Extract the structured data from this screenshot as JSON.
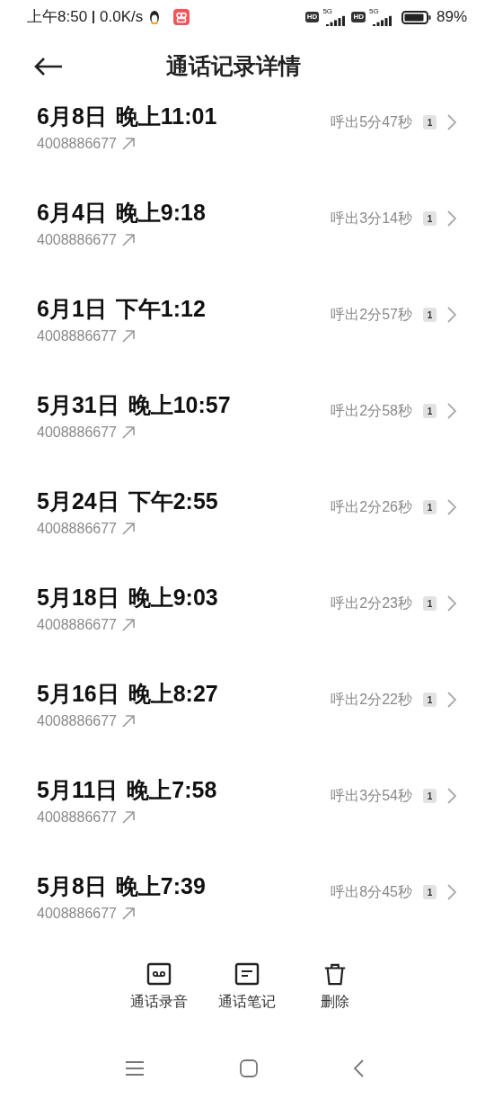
{
  "status_bar": {
    "time": "上午8:50",
    "speed": "0.0K/s",
    "sim_labels": [
      {
        "hd": "HD",
        "net": "5G"
      },
      {
        "hd": "HD",
        "net": "5G"
      }
    ],
    "battery": {
      "reading": "89%"
    }
  },
  "header": {
    "title": "通话记录详情"
  },
  "calls": [
    {
      "date": "6月8日",
      "time": "晚上11:01",
      "number": "4008886677",
      "detail": "呼出5分47秒",
      "sim": "1"
    },
    {
      "date": "6月4日",
      "time": "晚上9:18",
      "number": "4008886677",
      "detail": "呼出3分14秒",
      "sim": "1"
    },
    {
      "date": "6月1日",
      "time": "下午1:12",
      "number": "4008886677",
      "detail": "呼出2分57秒",
      "sim": "1"
    },
    {
      "date": "5月31日",
      "time": "晚上10:57",
      "number": "4008886677",
      "detail": "呼出2分58秒",
      "sim": "1"
    },
    {
      "date": "5月24日",
      "time": "下午2:55",
      "number": "4008886677",
      "detail": "呼出2分26秒",
      "sim": "1"
    },
    {
      "date": "5月18日",
      "time": "晚上9:03",
      "number": "4008886677",
      "detail": "呼出2分23秒",
      "sim": "1"
    },
    {
      "date": "5月16日",
      "time": "晚上8:27",
      "number": "4008886677",
      "detail": "呼出2分22秒",
      "sim": "1"
    },
    {
      "date": "5月11日",
      "time": "晚上7:58",
      "number": "4008886677",
      "detail": "呼出3分54秒",
      "sim": "1"
    },
    {
      "date": "5月8日",
      "time": "晚上7:39",
      "number": "4008886677",
      "detail": "呼出8分45秒",
      "sim": "1"
    }
  ],
  "actions": [
    {
      "kind": "recording",
      "label": "通话录音"
    },
    {
      "kind": "notes",
      "label": "通话笔记"
    },
    {
      "kind": "delete",
      "label": "删除"
    }
  ]
}
